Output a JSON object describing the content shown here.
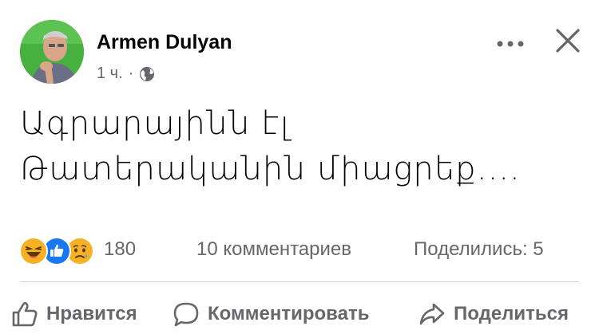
{
  "post": {
    "author": "Armen Dulyan",
    "time": "1 ч.",
    "separator": "·",
    "privacy_icon": "globe-icon",
    "text_lines": [
      "Ագրարայինն էլ",
      "Թատերականին միացրեք...."
    ]
  },
  "stats": {
    "reactions": [
      "haha",
      "like",
      "sad"
    ],
    "reaction_count": "180",
    "comments": "10 комментариев",
    "shares": "Поделились: 5"
  },
  "actions": {
    "like": "Нравится",
    "comment": "Комментировать",
    "share": "Поделиться"
  },
  "colors": {
    "accent": "#1877f2",
    "secondary_text": "#65676b",
    "avatar_bg": "#3fae3a",
    "haha": "#f7b125",
    "sad": "#f7b125"
  }
}
